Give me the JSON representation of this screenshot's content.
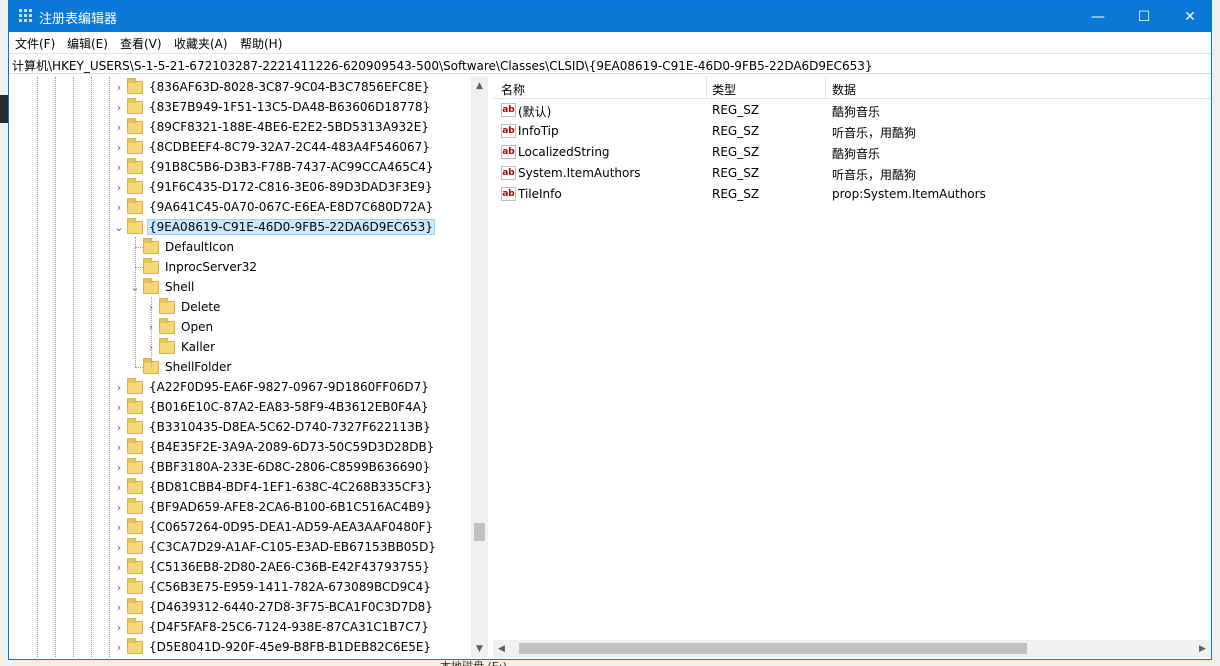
{
  "window": {
    "title": "注册表编辑器",
    "minimize": "—",
    "maximize": "☐",
    "close": "✕"
  },
  "menu": [
    "文件(F)",
    "编辑(E)",
    "查看(V)",
    "收藏夹(A)",
    "帮助(H)"
  ],
  "address": "计算机\\HKEY_USERS\\S-1-5-21-672103287-2221411226-620909543-500\\Software\\Classes\\CLSID\\{9EA08619-C91E-46D0-9FB5-22DA6D9EC653}",
  "tree": [
    {
      "label": "{836AF63D-8028-3C87-9C04-B3C7856EFC8E}",
      "chev": "›"
    },
    {
      "label": "{83E7B949-1F51-13C5-DA48-B63606D18778}",
      "chev": "›"
    },
    {
      "label": "{89CF8321-188E-4BE6-E2E2-5BD5313A932E}",
      "chev": "›"
    },
    {
      "label": "{8CDBEEF4-8C79-32A7-2C44-483A4F546067}",
      "chev": "›"
    },
    {
      "label": "{91B8C5B6-D3B3-F78B-7437-AC99CCA465C4}",
      "chev": "›"
    },
    {
      "label": "{91F6C435-D172-C816-3E06-89D3DAD3F3E9}",
      "chev": "›"
    },
    {
      "label": "{9A641C45-0A70-067C-E6EA-E8D7C680D72A}",
      "chev": "›"
    },
    {
      "label": "{9EA08619-C91E-46D0-9FB5-22DA6D9EC653}",
      "chev": "⌄"
    },
    {
      "label": "DefaultIcon",
      "chev": ""
    },
    {
      "label": "InprocServer32",
      "chev": ""
    },
    {
      "label": "Shell",
      "chev": "⌄"
    },
    {
      "label": "Delete",
      "chev": "›"
    },
    {
      "label": "Open",
      "chev": "›"
    },
    {
      "label": "Kaller",
      "chev": "›"
    },
    {
      "label": "ShellFolder",
      "chev": ""
    },
    {
      "label": "{A22F0D95-EA6F-9827-0967-9D1860FF06D7}",
      "chev": "›"
    },
    {
      "label": "{B016E10C-87A2-EA83-58F9-4B3612EB0F4A}",
      "chev": "›"
    },
    {
      "label": "{B3310435-D8EA-5C62-D740-7327F622113B}",
      "chev": "›"
    },
    {
      "label": "{B4E35F2E-3A9A-2089-6D73-50C59D3D28DB}",
      "chev": "›"
    },
    {
      "label": "{BBF3180A-233E-6D8C-2806-C8599B636690}",
      "chev": "›"
    },
    {
      "label": "{BD81CBB4-BDF4-1EF1-638C-4C268B335CF3}",
      "chev": "›"
    },
    {
      "label": "{BF9AD659-AFE8-2CA6-B100-6B1C516AC4B9}",
      "chev": "›"
    },
    {
      "label": "{C0657264-0D95-DEA1-AD59-AEA3AAF0480F}",
      "chev": "›"
    },
    {
      "label": "{C3CA7D29-A1AF-C105-E3AD-EB67153BB05D}",
      "chev": "›"
    },
    {
      "label": "{C5136EB8-2D80-2AE6-C36B-E42F43793755}",
      "chev": "›"
    },
    {
      "label": "{C56B3E75-E959-1411-782A-673089BCD9C4}",
      "chev": "›"
    },
    {
      "label": "{D4639312-6440-27D8-3F75-BCA1F0C3D7D8}",
      "chev": "›"
    },
    {
      "label": "{D4F5FAF8-25C6-7124-938E-87CA31C1B7C7}",
      "chev": "›"
    },
    {
      "label": "{D5E8041D-920F-45e9-B8FB-B1DEB82C6E5E}",
      "chev": "›"
    }
  ],
  "values": {
    "headers": {
      "name": "名称",
      "type": "类型",
      "data": "数据"
    },
    "rows": [
      {
        "icon": "ab",
        "name": "(默认)",
        "type": "REG_SZ",
        "data": "酷狗音乐"
      },
      {
        "icon": "ab",
        "name": "InfoTip",
        "type": "REG_SZ",
        "data": "听音乐，用酷狗"
      },
      {
        "icon": "ab",
        "name": "LocalizedString",
        "type": "REG_SZ",
        "data": "酷狗音乐"
      },
      {
        "icon": "ab",
        "name": "System.ItemAuthors",
        "type": "REG_SZ",
        "data": "听音乐，用酷狗"
      },
      {
        "icon": "ab",
        "name": "TileInfo",
        "type": "REG_SZ",
        "data": "prop:System.ItemAuthors"
      }
    ]
  },
  "scroll": {
    "up": "▲",
    "down": "▼",
    "left": "◀",
    "right": "▶"
  },
  "background_text": "本地磁盘 (E:)"
}
